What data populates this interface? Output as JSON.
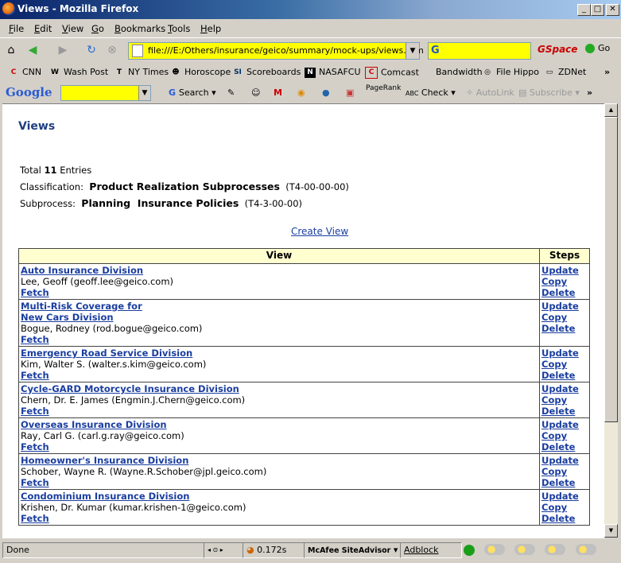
{
  "window": {
    "title": "Views - Mozilla Firefox"
  },
  "menu": [
    "File",
    "Edit",
    "View",
    "Go",
    "Bookmarks",
    "Tools",
    "Help"
  ],
  "nav": {
    "url": "file:///E:/Others/insurance/geico/summary/mock-ups/views.htm",
    "gspace": "GSpace",
    "go_label": "Go"
  },
  "bookmarks": [
    "CNN",
    "Wash Post",
    "NY Times",
    "Horoscope",
    "Scoreboards",
    "NASAFCU",
    "Comcast",
    "Bandwidth",
    "File Hippo",
    "ZDNet"
  ],
  "google_toolbar": {
    "logo": "Google",
    "search": "Search",
    "pagerank": "PageRank",
    "check": "Check",
    "autolink": "AutoLink",
    "subscribe": "Subscribe"
  },
  "page": {
    "heading": "Views",
    "total_prefix": "Total",
    "total_count": "11",
    "total_suffix": "Entries",
    "classification_label": "Classification:",
    "classification_value": "Product Realization Subprocesses",
    "classification_code": "(T4-00-00-00)",
    "subprocess_label": "Subprocess:",
    "subprocess_value": "Planning  Insurance Policies",
    "subprocess_code": "(T4-3-00-00)",
    "create_view": "Create View",
    "col_view": "View",
    "col_steps": "Steps",
    "fetch_label": "Fetch",
    "steps": {
      "update": "Update",
      "copy": "Copy",
      "delete": "Delete"
    },
    "rows": [
      {
        "name": [
          "Auto Insurance Division"
        ],
        "owner": "Lee, Geoff (geoff.lee@geico.com)"
      },
      {
        "name": [
          "Multi-Risk Coverage for",
          "New Cars Division"
        ],
        "owner": "Bogue, Rodney (rod.bogue@geico.com)"
      },
      {
        "name": [
          "Emergency Road Service Division"
        ],
        "owner": "Kim, Walter S. (walter.s.kim@geico.com)"
      },
      {
        "name": [
          "Cycle-GARD Motorcycle Insurance Division"
        ],
        "owner": "Chern, Dr. E. James (Engmin.J.Chern@geico.com)"
      },
      {
        "name": [
          "Overseas Insurance Division"
        ],
        "owner": "Ray, Carl G. (carl.g.ray@geico.com)"
      },
      {
        "name": [
          "Homeowner's Insurance Division"
        ],
        "owner": "Schober, Wayne R. (Wayne.R.Schober@jpl.geico.com)"
      },
      {
        "name": [
          "Condominium Insurance Division"
        ],
        "owner": "Krishen, Dr. Kumar (kumar.krishen-1@geico.com)"
      }
    ]
  },
  "status": {
    "text": "Done",
    "timer": "0.172s",
    "mcafee": "McAfee SiteAdvisor",
    "adblock": "Adblock"
  }
}
